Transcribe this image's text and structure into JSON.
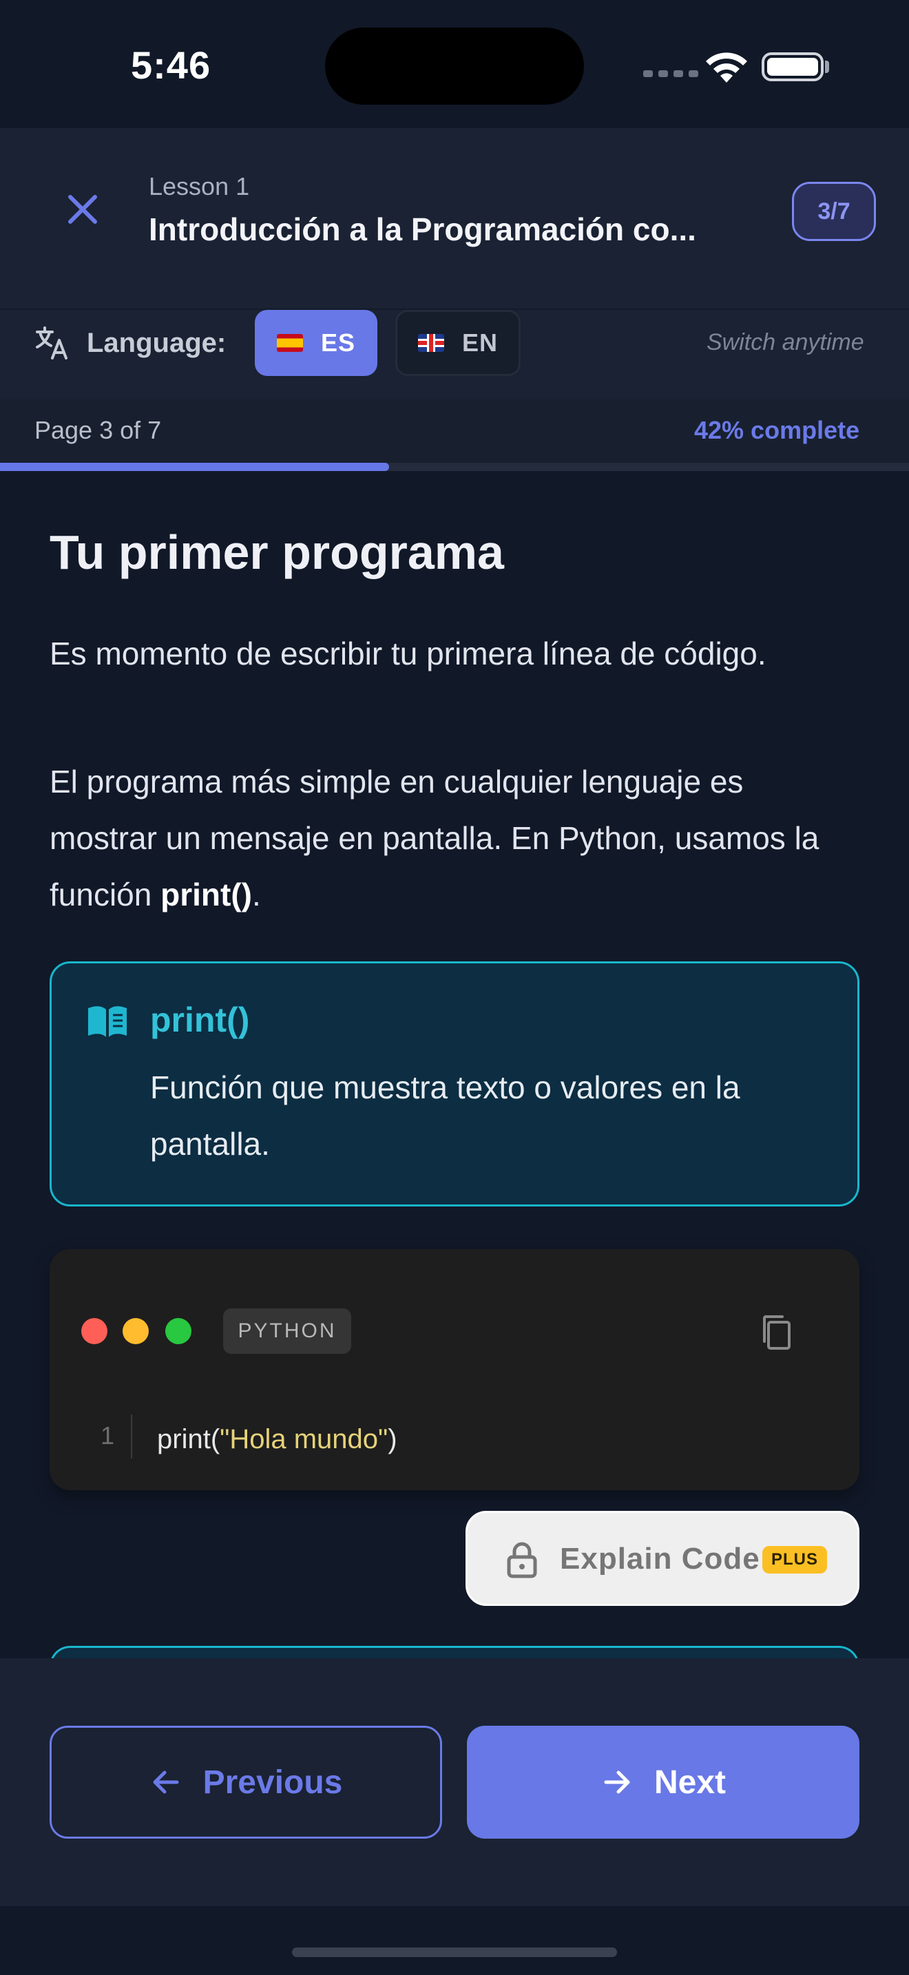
{
  "status_bar": {
    "time": "5:46"
  },
  "header": {
    "lesson_number": "Lesson 1",
    "lesson_title": "Introducción a la Programación co...",
    "page_badge": "3/7"
  },
  "language": {
    "label": "Language:",
    "options": [
      {
        "code": "ES",
        "flag": "spain-flag-icon",
        "selected": true
      },
      {
        "code": "EN",
        "flag": "uk-flag-icon",
        "selected": false
      }
    ],
    "hint": "Switch anytime"
  },
  "progress": {
    "page_text": "Page 3 of 7",
    "percent_text": "42% complete",
    "fraction": 0.428
  },
  "content": {
    "title": "Tu primer programa",
    "paragraph1": "Es momento de escribir tu primera línea de código.",
    "paragraph2_prefix": "El programa más simple en cualquier lenguaje es mostrar un mensaje en pantalla. En Python, usamos la función ",
    "paragraph2_bold": "print()",
    "paragraph2_suffix": ".",
    "definition": {
      "term": "print()",
      "text": "Función que muestra texto o valores en la pantalla."
    },
    "code_block": {
      "language": "PYTHON",
      "line_number": "1",
      "code_prefix": "print(",
      "code_string": "\"Hola mundo\"",
      "code_suffix": ")"
    },
    "explain_button": {
      "label": "Explain Code",
      "badge": "PLUS"
    }
  },
  "footer": {
    "previous_label": "Previous",
    "next_label": "Next"
  },
  "colors": {
    "accent": "#6878e6",
    "definition_border": "#18b6cc",
    "plus_badge": "#fbbf24"
  }
}
